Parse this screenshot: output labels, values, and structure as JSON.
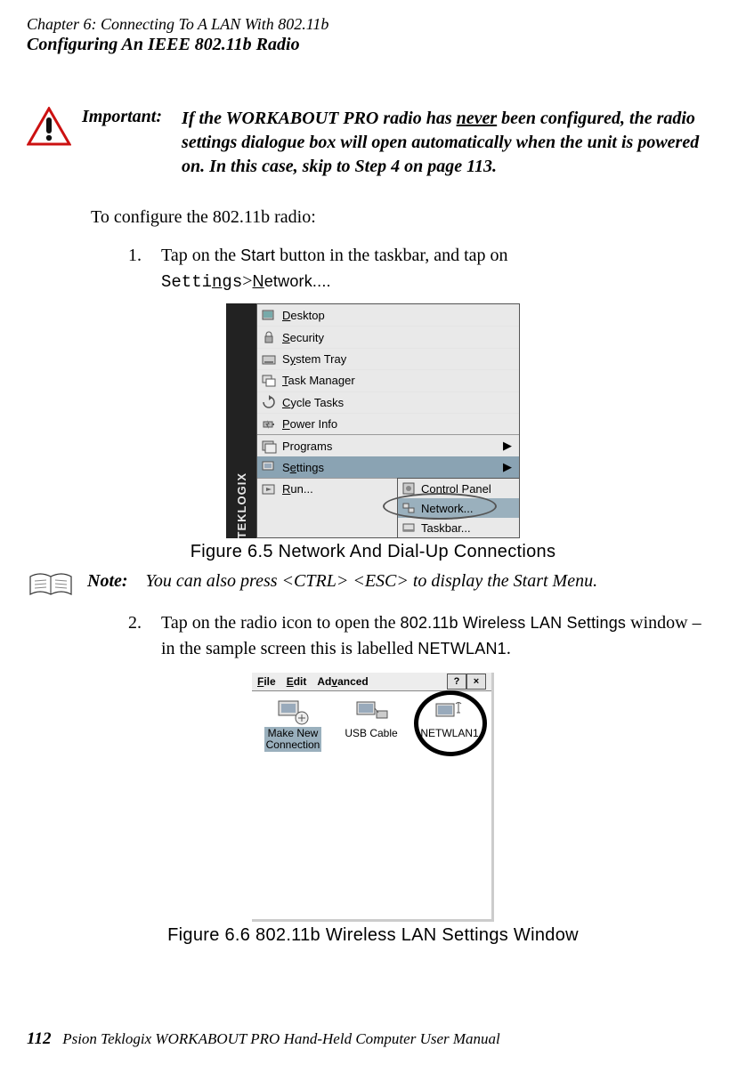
{
  "header": {
    "chapter_line": "Chapter 6: Connecting To A LAN With 802.11b",
    "section_line": "Configuring An IEEE 802.11b Radio"
  },
  "important": {
    "label": "Important:",
    "p1a": "If the WORKABOUT PRO radio has ",
    "never": "never",
    "p1b": " been configured, the radio settings dialogue box will open automatically when the unit is powered on. In this case, skip to Step 4 on page 113."
  },
  "intro": "To configure the 802.11b radio:",
  "step1": {
    "num": "1.",
    "a": "Tap on the ",
    "start_label": "Start",
    "b": " button in the taskbar, and tap on",
    "settings_mono_pre": "Setti",
    "settings_mono_u": "n",
    "settings_mono_post": "gs",
    "gt": ">",
    "network_u": "N",
    "network_rest": "etwork...."
  },
  "menu": {
    "items": [
      {
        "u": "D",
        "rest": "esktop"
      },
      {
        "u": "S",
        "rest": "ecurity"
      },
      {
        "plain_pre": "S",
        "u": "y",
        "plain_post": "stem Tray"
      },
      {
        "u": "T",
        "rest": "ask Manager"
      },
      {
        "u": "C",
        "rest": "ycle Tasks"
      },
      {
        "u": "P",
        "rest": "ower Info"
      },
      {
        "plain_pre": "Pro",
        "u": "g",
        "plain_post": "rams"
      },
      {
        "plain_pre": "S",
        "u": "e",
        "plain_post": "ttings"
      },
      {
        "u": "R",
        "rest": "un..."
      }
    ],
    "tek_label": "TEKLOGIX",
    "submenu": [
      {
        "u": "C",
        "rest": "ontrol Panel"
      },
      {
        "u": "N",
        "rest": "etwork..."
      },
      {
        "u": "T",
        "rest": "askbar..."
      }
    ]
  },
  "figure1_caption": "Figure 6.5 Network And Dial-Up Connections",
  "note": {
    "label": "Note:",
    "text": "You can also press <CTRL> <ESC> to display the Start Menu."
  },
  "step2": {
    "num": "2.",
    "a": "Tap on the radio icon to open the ",
    "wireless_label": "802.11b Wireless LAN Settings",
    "b": " window – in the sample screen this is labelled ",
    "netwlan_label": "NETWLAN1",
    "c": "."
  },
  "window2": {
    "menu_file_u": "F",
    "menu_file_rest": "ile",
    "menu_edit_u": "E",
    "menu_edit_rest": "dit",
    "menu_adv_pre": "Ad",
    "menu_adv_u": "v",
    "menu_adv_post": "anced",
    "help_btn": "?",
    "close_btn": "×",
    "icons": [
      {
        "label_l1": "Make New",
        "label_l2": "Connection"
      },
      {
        "label_l1": "USB Cable",
        "label_l2": ""
      },
      {
        "label_l1": "NETWLAN1",
        "label_l2": ""
      }
    ]
  },
  "figure2_caption": "Figure 6.6 802.11b Wireless LAN Settings Window",
  "footer": {
    "page_num": "112",
    "title": "Psion Teklogix WORKABOUT PRO Hand-Held Computer User Manual"
  }
}
